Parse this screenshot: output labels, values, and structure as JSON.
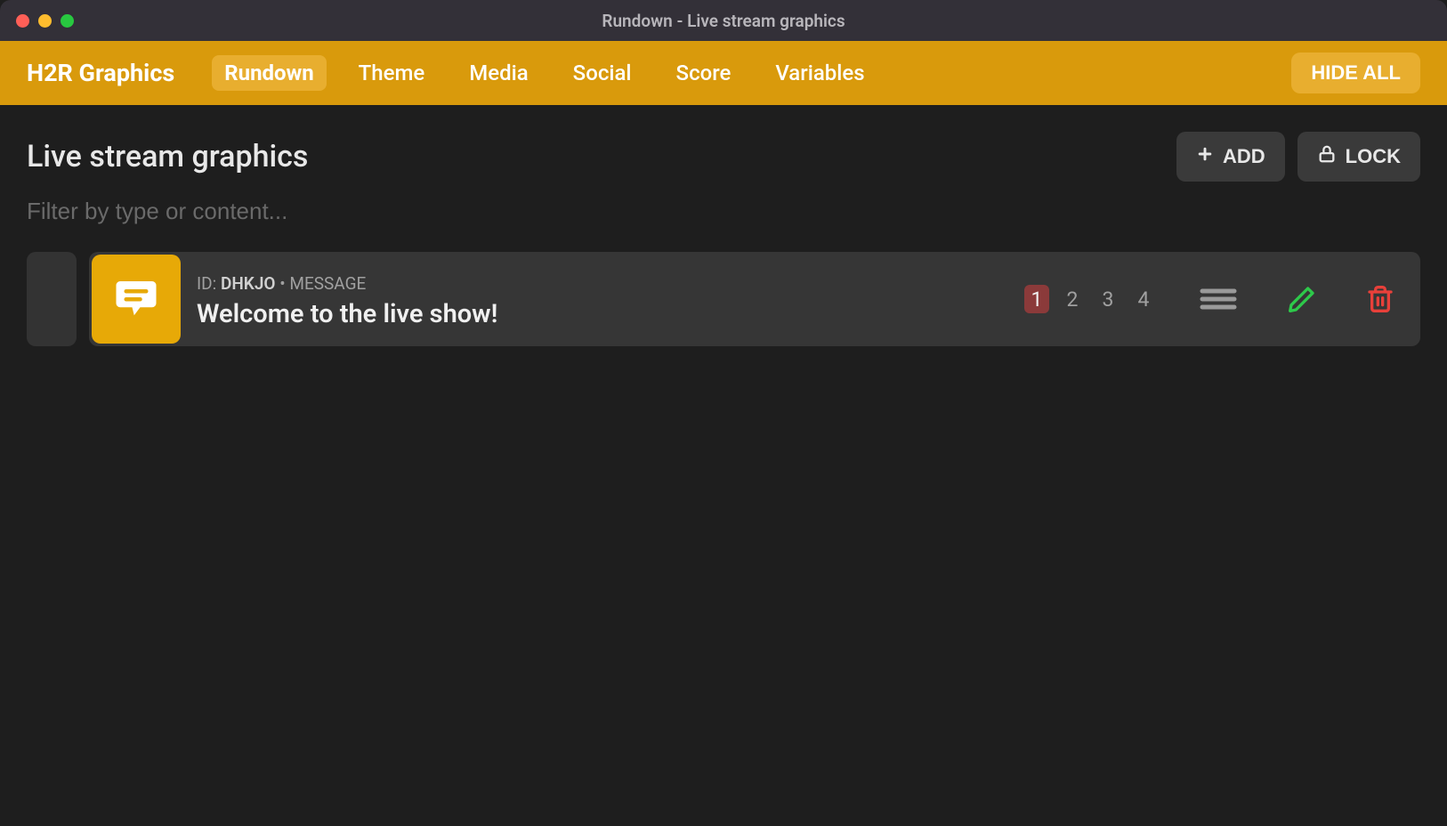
{
  "window": {
    "title": "Rundown - Live stream graphics"
  },
  "navbar": {
    "brand": "H2R Graphics",
    "tabs": [
      {
        "label": "Rundown",
        "active": true
      },
      {
        "label": "Theme",
        "active": false
      },
      {
        "label": "Media",
        "active": false
      },
      {
        "label": "Social",
        "active": false
      },
      {
        "label": "Score",
        "active": false
      },
      {
        "label": "Variables",
        "active": false
      }
    ],
    "hide_all_label": "HIDE ALL"
  },
  "page": {
    "title": "Live stream graphics",
    "filter_placeholder": "Filter by type or content...",
    "add_label": "ADD",
    "lock_label": "LOCK"
  },
  "rundown": {
    "items": [
      {
        "id_prefix": "ID: ",
        "id": "DHKJO",
        "separator": " • ",
        "type": "MESSAGE",
        "title": "Welcome to the live show!",
        "outputs": [
          {
            "label": "1",
            "active": true
          },
          {
            "label": "2",
            "active": false
          },
          {
            "label": "3",
            "active": false
          },
          {
            "label": "4",
            "active": false
          }
        ]
      }
    ]
  }
}
